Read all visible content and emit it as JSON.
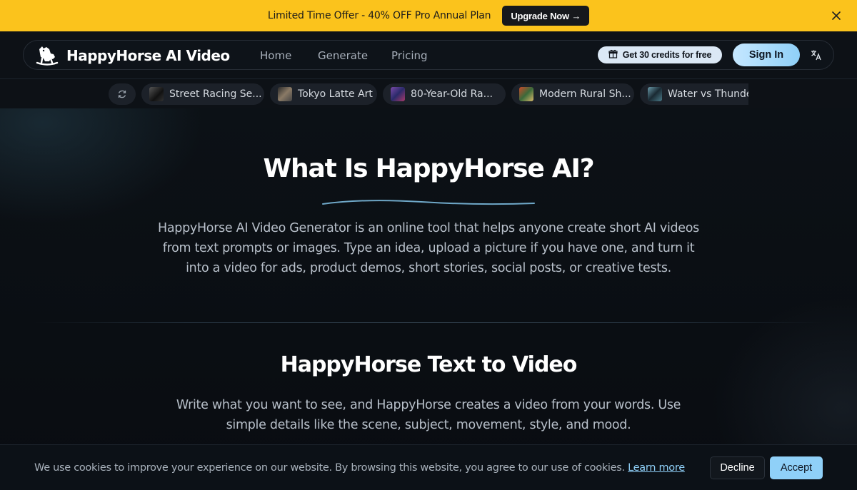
{
  "promo": {
    "text": "Limited Time Offer - 40% OFF Pro Annual Plan",
    "button_label": "Upgrade Now →"
  },
  "navbar": {
    "brand": "HappyHorse AI Video",
    "links": [
      "Home",
      "Generate",
      "Pricing"
    ],
    "credits_label": "Get 30 credits for free",
    "signin_label": "Sign In"
  },
  "chips": [
    {
      "label": "Street Racing Se...",
      "color": "#2a2e33"
    },
    {
      "label": "Tokyo Latte Art",
      "color": "#5a4a3a"
    },
    {
      "label": "80-Year-Old Ra...",
      "color": "#5b4a8a"
    },
    {
      "label": "Modern Rural Sh...",
      "color": "#8a3a2a"
    },
    {
      "label": "Water vs Thunde...",
      "color": "#3a5a66"
    }
  ],
  "section1": {
    "title": "What Is HappyHorse AI?",
    "body": "HappyHorse AI Video Generator is an online tool that helps anyone create short AI videos from text prompts or images. Type an idea, upload a picture if you have one, and turn it into a video for ads, product demos, short stories, social posts, or creative tests."
  },
  "section2": {
    "title": "HappyHorse Text to Video",
    "body": "Write what you want to see, and HappyHorse creates a video from your words. Use simple details like the scene, subject, movement, style, and mood."
  },
  "cookie": {
    "text": "We use cookies to improve your experience on our website. By browsing this website, you agree to our use of cookies.",
    "link": "Learn more",
    "decline": "Decline",
    "accept": "Accept"
  },
  "colors": {
    "promo_bg": "#fbc31c",
    "accent": "#8fd0f8"
  }
}
